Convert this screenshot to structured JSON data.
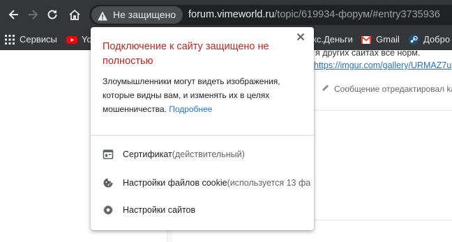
{
  "toolbar": {
    "security_label": "Не защищено",
    "url_host": "forum.vimeworld.ru",
    "url_path": "/topic/619934-форум/#entry3735936"
  },
  "bookmarks": [
    {
      "label": "Сервисы",
      "icon": "apps-grid-icon"
    },
    {
      "label": "Yo",
      "icon": "youtube-icon",
      "color": "#ff0000"
    },
    {
      "label": "кс.Деньги",
      "icon": "yandex-money-icon"
    },
    {
      "label": "Gmail",
      "icon": "gmail-icon",
      "color": "#ea4335"
    },
    {
      "label": "Добро",
      "icon": "steam-icon",
      "color": "#1b2838"
    }
  ],
  "page": {
    "line1": "я других сайтах все норм.",
    "link": "https://imgur.com/gallery/URMAZ7u",
    "edited": "Сообщение отредактировал karin"
  },
  "popup": {
    "title": "Подключение к сайту защищено не полностью",
    "description": "Злоумышленники могут видеть изображения, которые видны вам, и изменять их в целях мошенничества.",
    "more_link": "Подробнее",
    "rows": [
      {
        "label": "Сертификат",
        "detail": " (действительный)",
        "icon": "certificate-icon"
      },
      {
        "label": "Настройки файлов cookie",
        "detail": " (используется 13 фа",
        "icon": "cookie-icon"
      },
      {
        "label": "Настройки сайтов",
        "detail": "",
        "icon": "gear-icon"
      }
    ]
  },
  "colors": {
    "chrome_dark": "#35363a",
    "warning_title": "#c5221f",
    "link_blue": "#1a73e8"
  }
}
